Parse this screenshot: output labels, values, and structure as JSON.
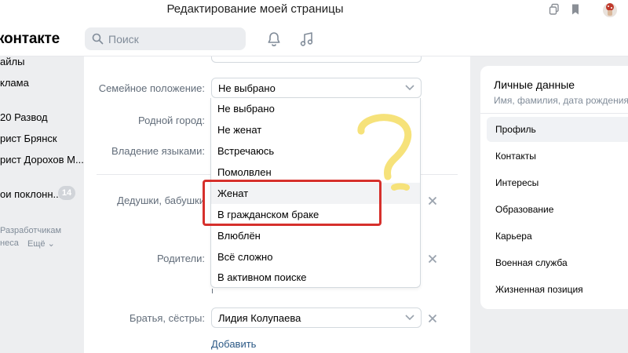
{
  "window": {
    "title": "Редактирование моей страницы"
  },
  "header": {
    "logo": "контакте",
    "search_placeholder": "Поиск"
  },
  "left_nav": {
    "items": [
      "айлы",
      "клама",
      "20 Развод",
      "рист Брянск",
      "рист Дорохов М...",
      "ои поклонн..."
    ],
    "badge": "14",
    "footer_line1": "Разработчикам",
    "footer_line2": "неса",
    "footer_more": "Ещё"
  },
  "form": {
    "marital_label": "Семейное положение:",
    "marital_value": "Не выбрано",
    "hometown_label": "Родной город:",
    "languages_label": "Владение языками:",
    "grandparents_label": "Дедушки, бабушки",
    "parents_label": "Родители:",
    "siblings_label": "Братья, сёстры:",
    "sibling_value": "Лидия Колупаева",
    "add_link": "Добавить"
  },
  "dropdown": {
    "options": [
      "Не выбрано",
      "Не женат",
      "Встречаюсь",
      "Помолвлен",
      "Женат",
      "В гражданском браке",
      "Влюблён",
      "Всё сложно",
      "В активном поиске"
    ],
    "highlighted_index": 4
  },
  "right_menu": {
    "title": "Личные данные",
    "subtitle": "Имя, фамилия, дата рождения,",
    "items": [
      "Профиль",
      "Контакты",
      "Интересы",
      "Образование",
      "Карьера",
      "Военная служба",
      "Жизненная позиция"
    ],
    "active_index": 0
  },
  "colors": {
    "link": "#2a5885",
    "annotation_red": "#d6302c",
    "doodle_yellow": "#f6e27a",
    "page_bg": "#edeef0"
  }
}
